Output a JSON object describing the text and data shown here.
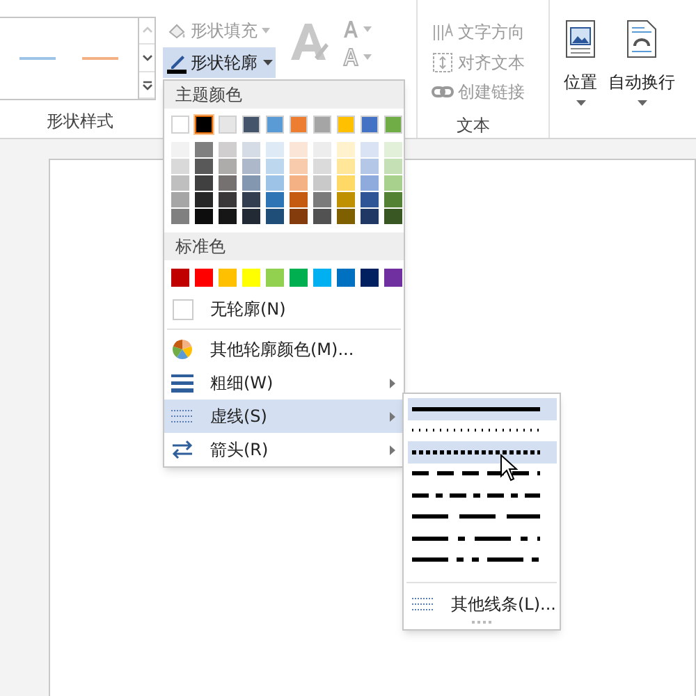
{
  "ribbon": {
    "gallery": {
      "lines": [
        {
          "color": "#9dc3e6"
        },
        {
          "color": "#f4b183"
        }
      ]
    },
    "shape_fill": {
      "label": "形状填充",
      "disabled": true
    },
    "shape_outline": {
      "label": "形状轮廓",
      "selected": true
    },
    "group_labels": [
      {
        "label": "形状样式"
      },
      {
        "label": "文本"
      }
    ],
    "text_commands": [
      {
        "label": "文字方向",
        "kind": "direction",
        "disabled": true
      },
      {
        "label": "对齐文本",
        "kind": "align",
        "disabled": true
      },
      {
        "label": "创建链接",
        "kind": "link",
        "disabled": true
      }
    ],
    "arrange": [
      {
        "label": "位置",
        "kind": "position"
      },
      {
        "label": "自动换行",
        "kind": "wrap"
      }
    ]
  },
  "outline_menu": {
    "theme_header": "主题颜色",
    "theme_colors": [
      {
        "color": "#ffffff",
        "selected": false,
        "shades": [
          {
            "color": "#f2f2f2"
          },
          {
            "color": "#d9d9d9"
          },
          {
            "color": "#bfbfbf"
          },
          {
            "color": "#a6a6a6"
          },
          {
            "color": "#808080"
          }
        ]
      },
      {
        "color": "#000000",
        "selected": true,
        "shades": [
          {
            "color": "#7f7f7f"
          },
          {
            "color": "#595959"
          },
          {
            "color": "#404040"
          },
          {
            "color": "#262626"
          },
          {
            "color": "#0d0d0d"
          }
        ]
      },
      {
        "color": "#e7e6e6",
        "selected": false,
        "shades": [
          {
            "color": "#d0cece"
          },
          {
            "color": "#aeabab"
          },
          {
            "color": "#757171"
          },
          {
            "color": "#3a3838"
          },
          {
            "color": "#171616"
          }
        ]
      },
      {
        "color": "#44546a",
        "selected": false,
        "shades": [
          {
            "color": "#d6dce5"
          },
          {
            "color": "#adb9ca"
          },
          {
            "color": "#8497b0"
          },
          {
            "color": "#333f50"
          },
          {
            "color": "#222a35"
          }
        ]
      },
      {
        "color": "#5b9bd5",
        "selected": false,
        "shades": [
          {
            "color": "#deebf7"
          },
          {
            "color": "#bdd7ee"
          },
          {
            "color": "#9dc3e6"
          },
          {
            "color": "#2e75b6"
          },
          {
            "color": "#1f4e79"
          }
        ]
      },
      {
        "color": "#ed7d31",
        "selected": false,
        "shades": [
          {
            "color": "#fbe5d6"
          },
          {
            "color": "#f8cbad"
          },
          {
            "color": "#f4b183"
          },
          {
            "color": "#c55a11"
          },
          {
            "color": "#843c0c"
          }
        ]
      },
      {
        "color": "#a5a5a5",
        "selected": false,
        "shades": [
          {
            "color": "#ededed"
          },
          {
            "color": "#dbdbdb"
          },
          {
            "color": "#c9c9c9"
          },
          {
            "color": "#7b7b7b"
          },
          {
            "color": "#525252"
          }
        ]
      },
      {
        "color": "#ffc000",
        "selected": false,
        "shades": [
          {
            "color": "#fff2cc"
          },
          {
            "color": "#ffe699"
          },
          {
            "color": "#ffd966"
          },
          {
            "color": "#bf9000"
          },
          {
            "color": "#7f6000"
          }
        ]
      },
      {
        "color": "#4472c4",
        "selected": false,
        "shades": [
          {
            "color": "#dae3f3"
          },
          {
            "color": "#b4c7e7"
          },
          {
            "color": "#8faadc"
          },
          {
            "color": "#2f5597"
          },
          {
            "color": "#203864"
          }
        ]
      },
      {
        "color": "#70ad47",
        "selected": false,
        "shades": [
          {
            "color": "#e2f0d9"
          },
          {
            "color": "#c5e0b4"
          },
          {
            "color": "#a9d18e"
          },
          {
            "color": "#548235"
          },
          {
            "color": "#385723"
          }
        ]
      }
    ],
    "standard_header": "标准色",
    "standard_colors": [
      {
        "color": "#c00000"
      },
      {
        "color": "#ff0000"
      },
      {
        "color": "#ffc000"
      },
      {
        "color": "#ffff00"
      },
      {
        "color": "#92d050"
      },
      {
        "color": "#00b050"
      },
      {
        "color": "#00b0f0"
      },
      {
        "color": "#0070c0"
      },
      {
        "color": "#002060"
      },
      {
        "color": "#7030a0"
      }
    ],
    "items": [
      {
        "label": "无轮廓(N)",
        "kind": "none",
        "submenu": false,
        "selected": false
      },
      {
        "label": "其他轮廓颜色(M)...",
        "kind": "palette",
        "submenu": false,
        "selected": false
      },
      {
        "label": "粗细(W)",
        "kind": "weight",
        "submenu": true,
        "selected": false
      },
      {
        "label": "虚线(S)",
        "kind": "dash",
        "submenu": true,
        "selected": true
      },
      {
        "label": "箭头(R)",
        "kind": "arrows",
        "submenu": true,
        "selected": false
      }
    ]
  },
  "dash_menu": {
    "styles": [
      {
        "kind": "solid",
        "selected": true
      },
      {
        "kind": "round-dot",
        "selected": false
      },
      {
        "kind": "square-dot",
        "selected": true
      },
      {
        "kind": "dash",
        "selected": false
      },
      {
        "kind": "dash-dot",
        "selected": false
      },
      {
        "kind": "long-dash",
        "selected": false
      },
      {
        "kind": "long-dash-dot",
        "selected": false
      },
      {
        "kind": "long-dash-dot-dot",
        "selected": false
      }
    ],
    "more": "其他线条(L)..."
  }
}
